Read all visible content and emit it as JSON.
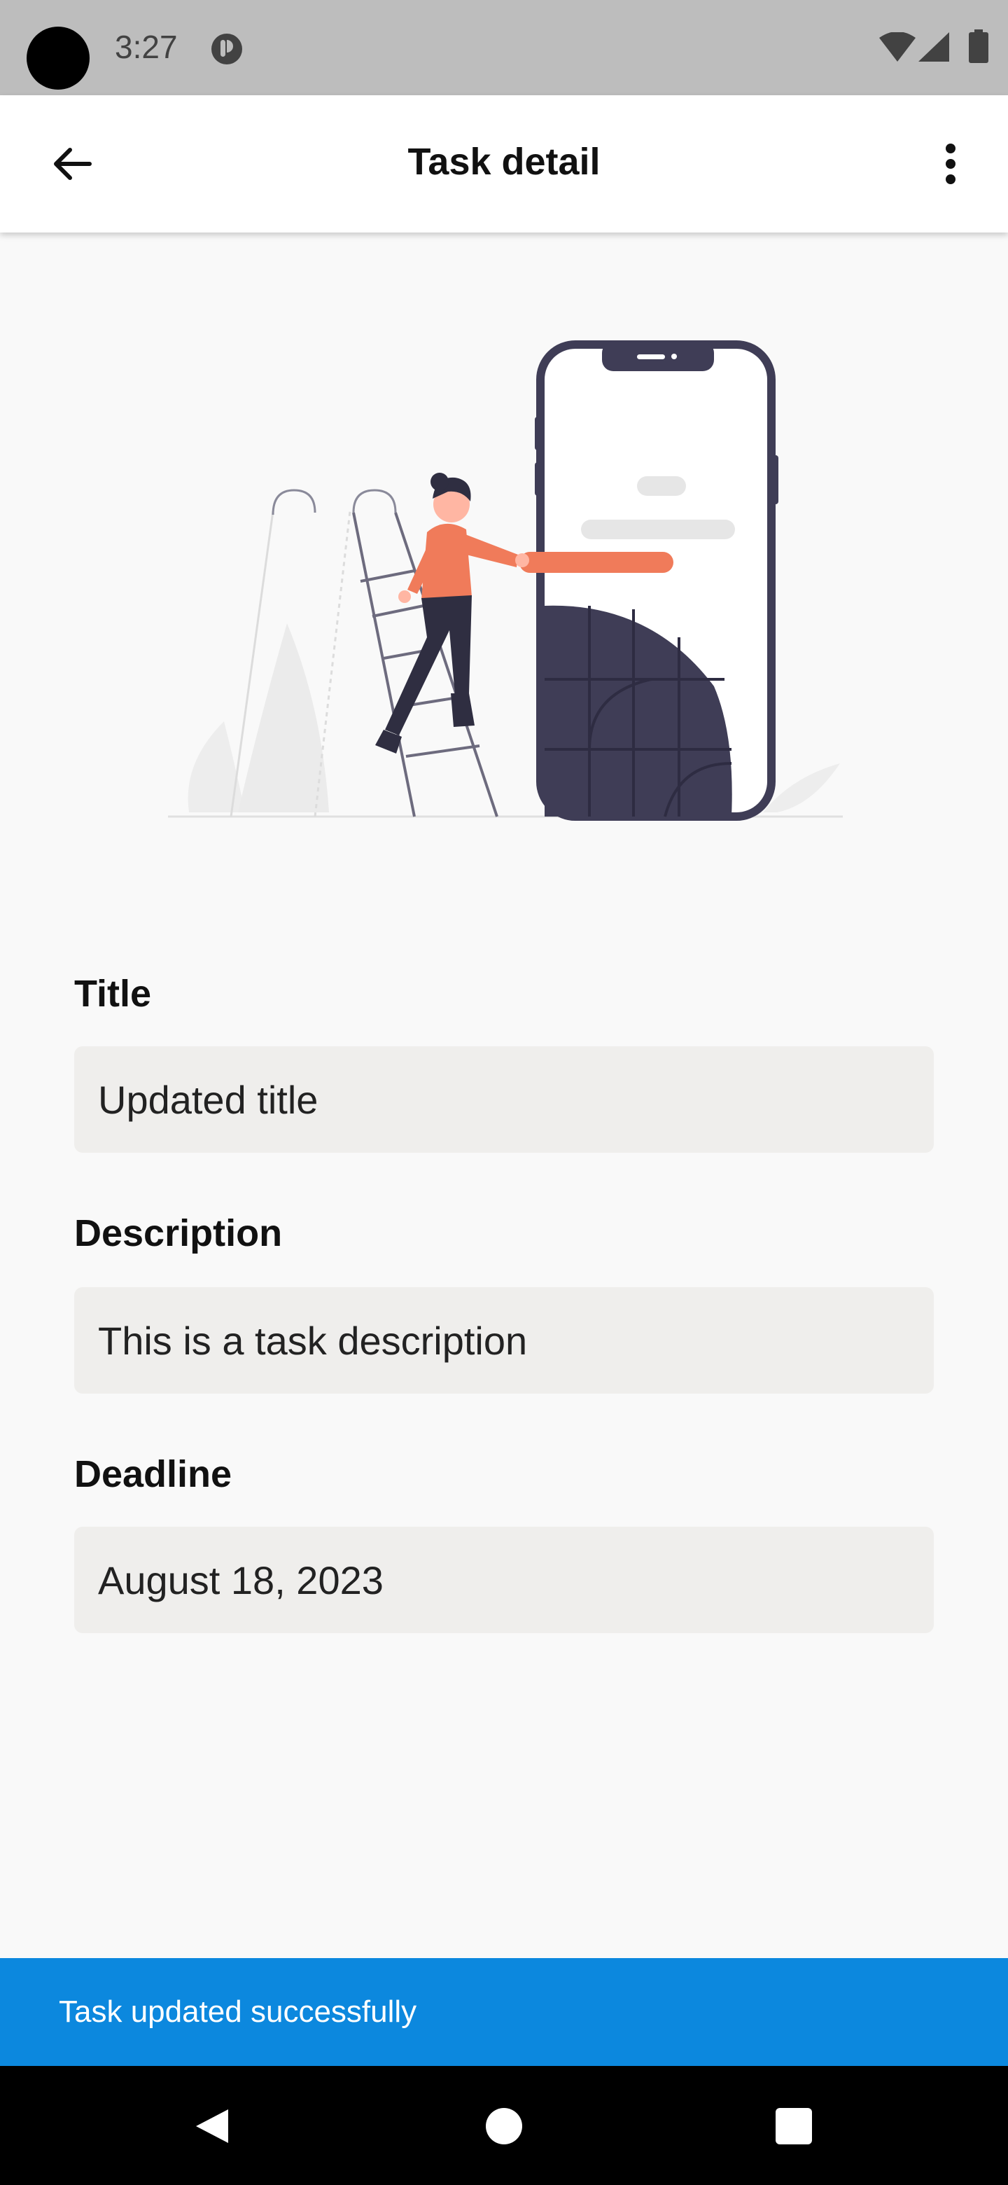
{
  "status_bar": {
    "time": "3:27",
    "icons": [
      "camera-cutout",
      "app-notification-icon",
      "wifi-icon",
      "signal-icon",
      "battery-icon"
    ]
  },
  "app_bar": {
    "title": "Task detail",
    "back_icon": "arrow-left-icon",
    "menu_icon": "more-vert-icon"
  },
  "illustration": {
    "description_icon": "person-climbing-ladder-phone-illustration",
    "accent_color": "#F07B5A",
    "dark_color": "#3F3D56"
  },
  "form": {
    "title_label": "Title",
    "title_value": "Updated title",
    "description_label": "Description",
    "description_value": "This is a task description",
    "deadline_label": "Deadline",
    "deadline_value": "August 18, 2023"
  },
  "snackbar": {
    "message": "Task updated successfully",
    "color": "#0C88DE"
  },
  "nav_bar": {
    "icons": [
      "nav-back-icon",
      "nav-home-icon",
      "nav-recents-icon"
    ]
  }
}
